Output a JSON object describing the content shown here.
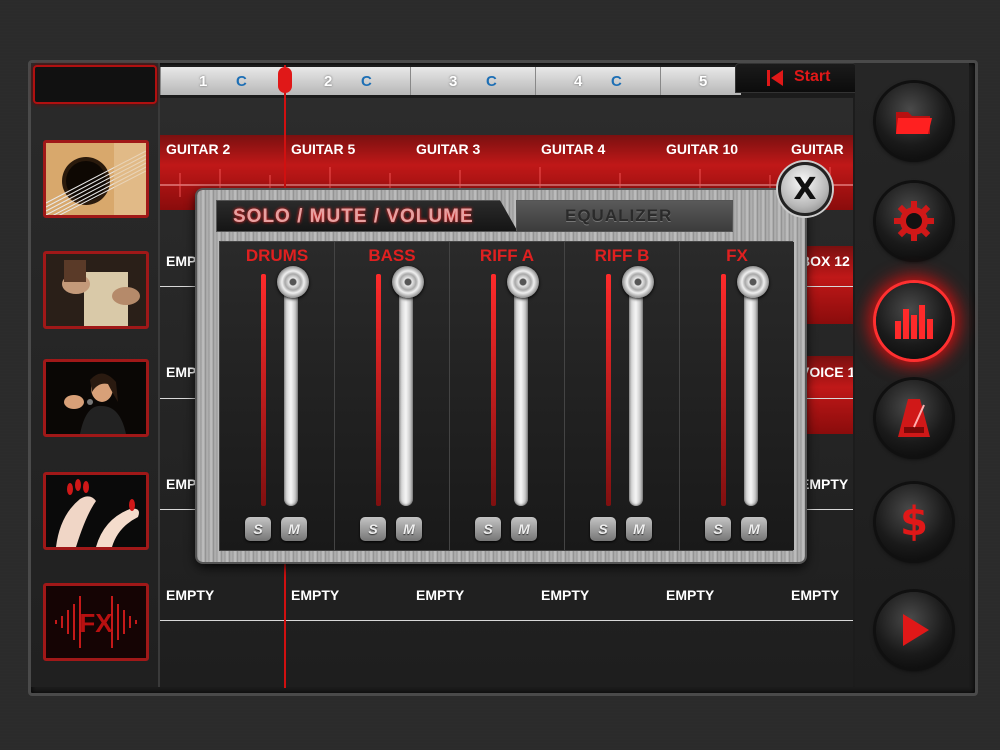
{
  "app": {
    "title_box_text": "",
    "colors": {
      "accent": "#d01818",
      "panel": "#1e1e1e",
      "metal": "#a8a8a8"
    }
  },
  "ruler": {
    "segments": [
      {
        "number": "1",
        "key": "C"
      },
      {
        "number": "2",
        "key": "C"
      },
      {
        "number": "3",
        "key": "C"
      },
      {
        "number": "4",
        "key": "C"
      },
      {
        "number": "5",
        "key": ""
      }
    ],
    "start_label": "Start"
  },
  "left_instruments": [
    {
      "name": "guitar",
      "icon": "guitar-photo"
    },
    {
      "name": "cajon",
      "icon": "cajon-photo"
    },
    {
      "name": "voice",
      "icon": "singer-photo"
    },
    {
      "name": "claps",
      "icon": "hands-clapping-photo"
    },
    {
      "name": "fx",
      "icon": "fx-waveform",
      "label": "FX"
    }
  ],
  "tracks": {
    "row1": [
      "GUITAR 2",
      "GUITAR 5",
      "GUITAR 3",
      "GUITAR 4",
      "GUITAR 10",
      "GUITAR"
    ],
    "row2_left": "EMPTY",
    "row2_right": "BOX 12",
    "row3_left": "EMPTY",
    "row3_right": "VOICE 1",
    "row4_left": "EMPTY",
    "row4_right": "EMPTY",
    "row5": [
      "EMPTY",
      "EMPTY",
      "EMPTY",
      "EMPTY",
      "EMPTY",
      "EMPTY"
    ]
  },
  "right_buttons": [
    {
      "name": "folder",
      "icon": "folder-icon",
      "active": false
    },
    {
      "name": "settings",
      "icon": "gear-icon",
      "active": false
    },
    {
      "name": "mixer",
      "icon": "bars-chart-icon",
      "active": true
    },
    {
      "name": "metronome",
      "icon": "metronome-icon",
      "active": false
    },
    {
      "name": "store",
      "icon": "dollar-icon",
      "active": false
    },
    {
      "name": "play",
      "icon": "play-icon",
      "active": false
    }
  ],
  "mixer": {
    "close_label": "X",
    "tabs": {
      "solo_mute_volume": "SOLO / MUTE / VOLUME",
      "equalizer": "EQUALIZER"
    },
    "channels": [
      {
        "name": "DRUMS",
        "solo": "S",
        "mute": "M",
        "volume_fraction": 1.0
      },
      {
        "name": "BASS",
        "solo": "S",
        "mute": "M",
        "volume_fraction": 1.0
      },
      {
        "name": "RIFF A",
        "solo": "S",
        "mute": "M",
        "volume_fraction": 1.0
      },
      {
        "name": "RIFF B",
        "solo": "S",
        "mute": "M",
        "volume_fraction": 1.0
      },
      {
        "name": "FX",
        "solo": "S",
        "mute": "M",
        "volume_fraction": 1.0
      }
    ]
  }
}
